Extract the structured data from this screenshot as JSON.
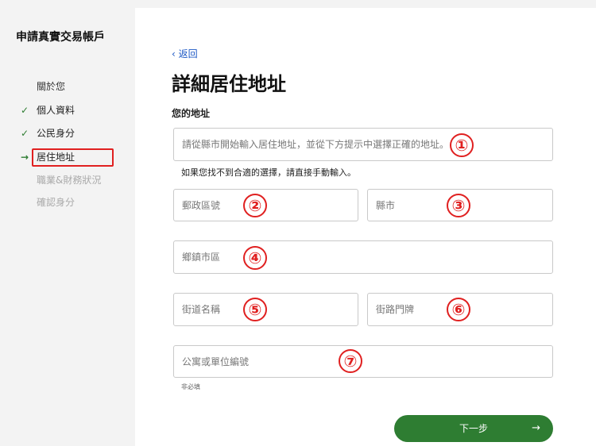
{
  "app": {
    "title": "申請真實交易帳戶"
  },
  "steps": [
    {
      "label": "關於您",
      "state": "header"
    },
    {
      "label": "個人資料",
      "state": "done"
    },
    {
      "label": "公民身分",
      "state": "done"
    },
    {
      "label": "居住地址",
      "state": "current"
    },
    {
      "label": "職業&財務狀況",
      "state": "pending"
    },
    {
      "label": "確認身分",
      "state": "pending"
    }
  ],
  "icons": {
    "done": "check-icon",
    "current": "arrow-right-icon",
    "back": "chevron-left-icon"
  },
  "colors": {
    "accent": "#2e7d32",
    "link": "#1a56c4",
    "annotation": "#e02020"
  },
  "form": {
    "back_label": "返回",
    "title": "詳細居住地址",
    "section_label": "您的地址",
    "address_search_placeholder": "請從縣市開始輸入居住地址，並從下方提示中選擇正確的地址。",
    "manual_hint": "如果您找不到合適的選擇，請直接手動輸入。",
    "postal_code_placeholder": "郵政區號",
    "county_city_placeholder": "縣市",
    "township_placeholder": "鄉鎮市區",
    "street_name_placeholder": "街道名稱",
    "street_number_placeholder": "街路門牌",
    "apartment_placeholder": "公寓或單位編號",
    "optional_label": "非必填",
    "next_label": "下一步"
  },
  "annotations": [
    "①",
    "②",
    "③",
    "④",
    "⑤",
    "⑥",
    "⑦"
  ]
}
